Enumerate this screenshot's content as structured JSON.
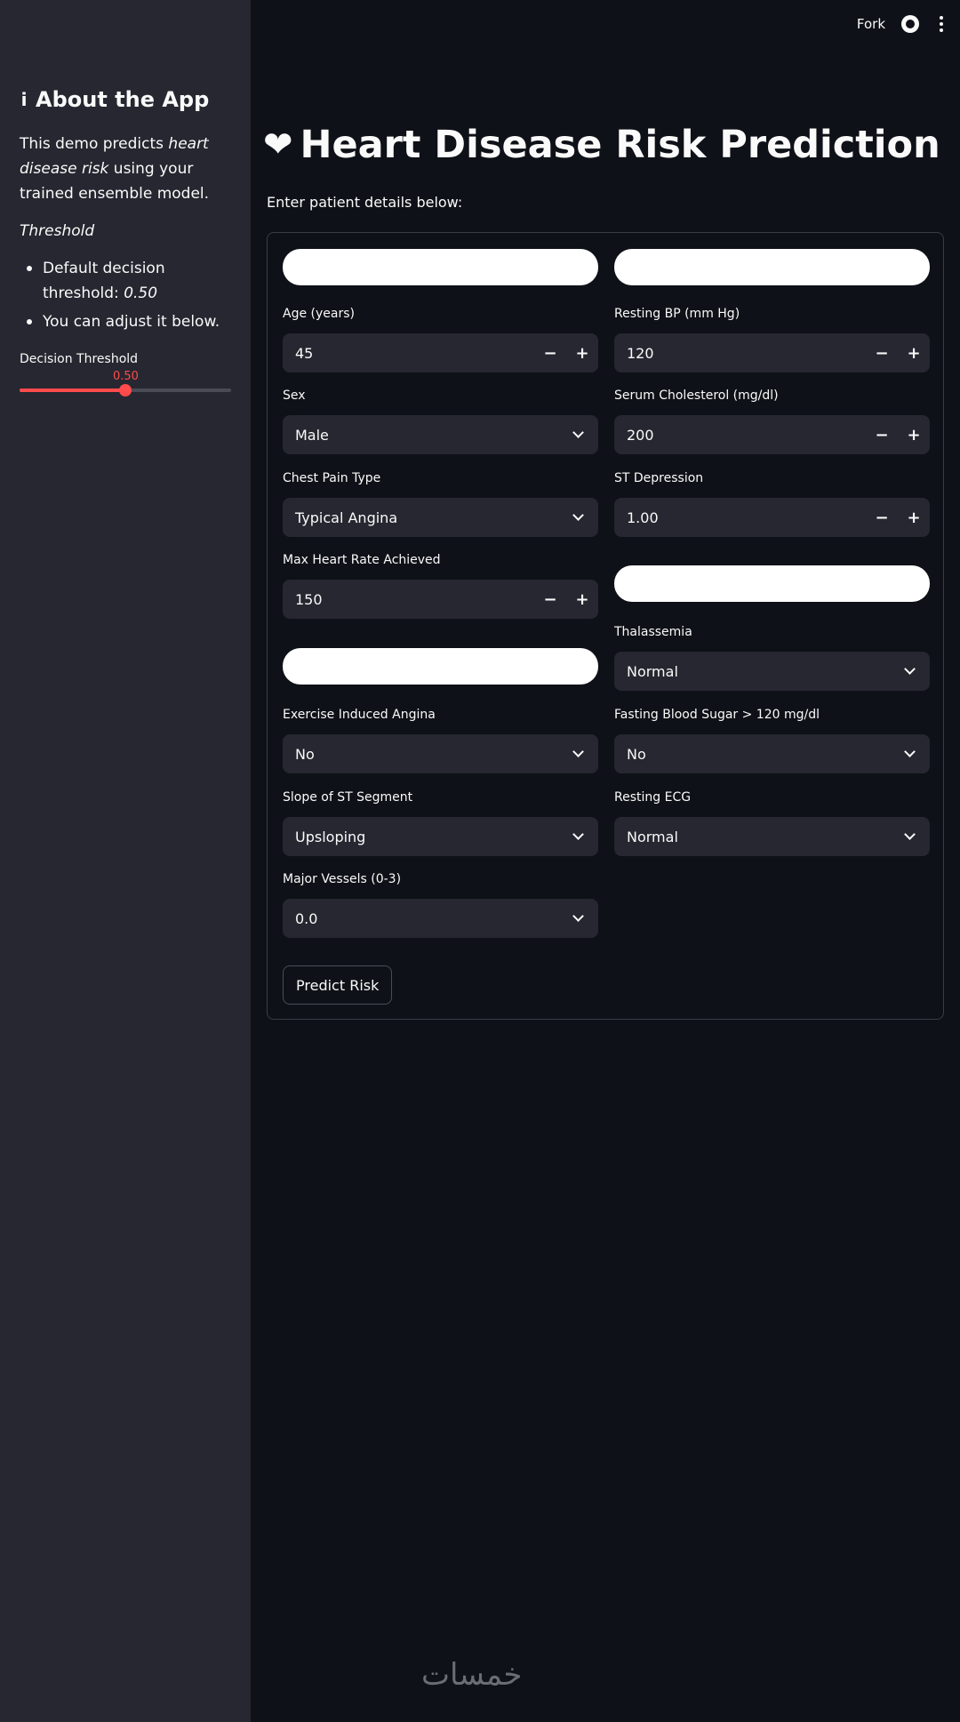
{
  "sidebar": {
    "heading": "About the App",
    "intro_before": "This demo predicts ",
    "intro_emph": "heart disease risk",
    "intro_after": " using your trained ensemble model.",
    "threshold_heading": "Threshold",
    "bullet1_text": "Default decision threshold: ",
    "bullet1_value": "0.50",
    "bullet2_text": "You can adjust it below.",
    "slider_label": "Decision Threshold",
    "slider_value": "0.50",
    "slider_fraction": 0.5
  },
  "topbar": {
    "fork_label": "Fork"
  },
  "main": {
    "title": "Heart Disease Risk Prediction",
    "subtitle": "Enter patient details below:"
  },
  "form": {
    "age": {
      "label": "Age (years)",
      "value": "45"
    },
    "resting_bp": {
      "label": "Resting BP (mm Hg)",
      "value": "120"
    },
    "sex": {
      "label": "Sex",
      "value": "Male"
    },
    "cholesterol": {
      "label": "Serum Cholesterol (mg/dl)",
      "value": "200"
    },
    "chest_pain": {
      "label": "Chest Pain Type",
      "value": "Typical Angina"
    },
    "st_depression": {
      "label": "ST Depression",
      "value": "1.00"
    },
    "max_hr": {
      "label": "Max Heart Rate Achieved",
      "value": "150"
    },
    "thalassemia": {
      "label": "Thalassemia",
      "value": "Normal"
    },
    "exercise_angina": {
      "label": "Exercise Induced Angina",
      "value": "No"
    },
    "fasting_bs": {
      "label": "Fasting Blood Sugar > 120 mg/dl",
      "value": "No"
    },
    "slope": {
      "label": "Slope of ST Segment",
      "value": "Upsloping"
    },
    "resting_ecg": {
      "label": "Resting ECG",
      "value": "Normal"
    },
    "major_vessels": {
      "label": "Major Vessels (0-3)",
      "value": "0.0"
    },
    "predict_label": "Predict Risk"
  },
  "watermark": "خمسات"
}
